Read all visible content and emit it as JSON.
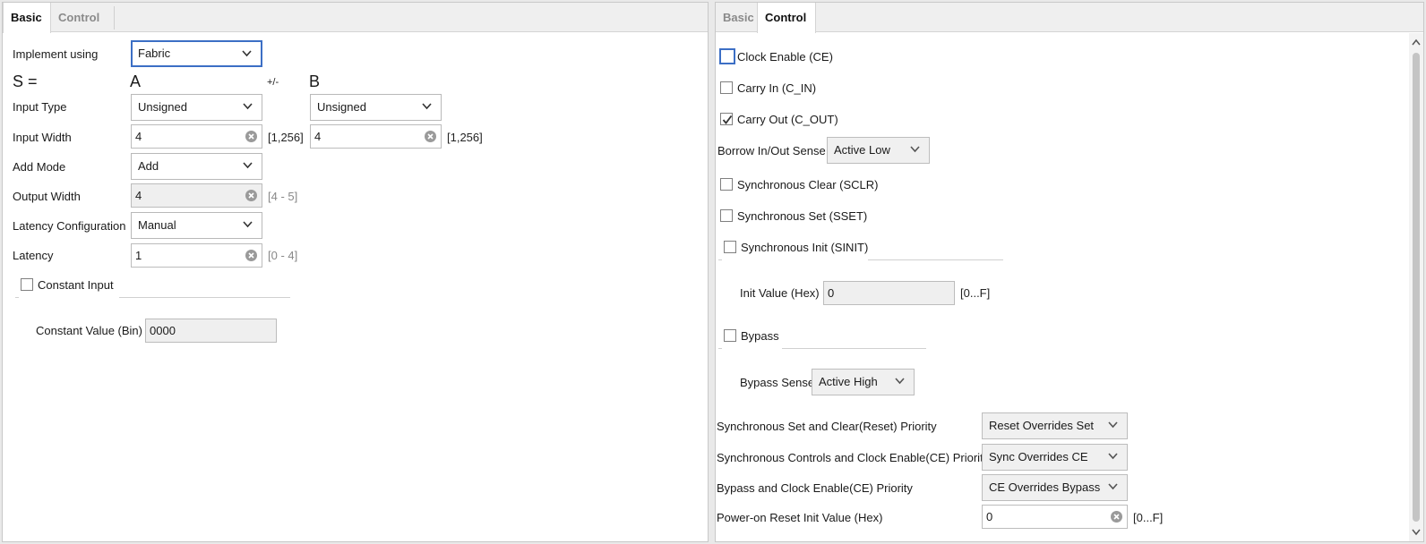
{
  "left": {
    "tabs": [
      {
        "label": "Basic",
        "active": true
      },
      {
        "label": "Control",
        "active": false
      }
    ],
    "implement_label": "Implement using",
    "implement_value": "Fabric",
    "s_label": "S =",
    "a_label": "A",
    "op_label": "+/-",
    "b_label": "B",
    "input_type_label": "Input Type",
    "input_type_a": "Unsigned",
    "input_type_b": "Unsigned",
    "input_width_label": "Input Width",
    "input_width_a": "4",
    "input_width_a_range": "[1,256]",
    "input_width_b": "4",
    "input_width_b_range": "[1,256]",
    "add_mode_label": "Add Mode",
    "add_mode_value": "Add",
    "output_width_label": "Output Width",
    "output_width_value": "4",
    "output_width_range": "[4 - 5]",
    "latency_config_label": "Latency Configuration",
    "latency_config_value": "Manual",
    "latency_label": "Latency",
    "latency_value": "1",
    "latency_range": "[0 - 4]",
    "constant_input_label": "Constant Input",
    "constant_input_checked": false,
    "constant_value_label": "Constant Value (Bin)",
    "constant_value": "0000"
  },
  "right": {
    "tabs": [
      {
        "label": "Basic",
        "active": false
      },
      {
        "label": "Control",
        "active": true
      }
    ],
    "ce_label": "Clock Enable (CE)",
    "ce_checked": false,
    "c_in_label": "Carry In (C_IN)",
    "c_in_checked": false,
    "c_out_label": "Carry Out (C_OUT)",
    "c_out_checked": true,
    "borrow_label": "Borrow In/Out Sense",
    "borrow_value": "Active Low",
    "sclr_label": "Synchronous Clear (SCLR)",
    "sset_label": "Synchronous Set (SSET)",
    "sinit_label": "Synchronous Init (SINIT)",
    "init_value_label": "Init Value (Hex)",
    "init_value": "0",
    "init_value_range": "[0...F]",
    "bypass_label": "Bypass",
    "bypass_sense_label": "Bypass Sense",
    "bypass_sense_value": "Active High",
    "set_clear_priority_label": "Synchronous Set and Clear(Reset) Priority",
    "set_clear_priority_value": "Reset Overrides Set",
    "sync_ce_priority_label": "Synchronous Controls and Clock Enable(CE) Priority",
    "sync_ce_priority_value": "Sync Overrides CE",
    "bypass_ce_priority_label": "Bypass and Clock Enable(CE) Priority",
    "bypass_ce_priority_value": "CE Overrides Bypass",
    "poweron_label": "Power-on Reset Init Value (Hex)",
    "poweron_value": "0",
    "poweron_range": "[0...F]"
  },
  "colors": {
    "focus": "#3c6fc5",
    "panel_bg": "#ffffff",
    "tab_bg": "#efefef"
  }
}
